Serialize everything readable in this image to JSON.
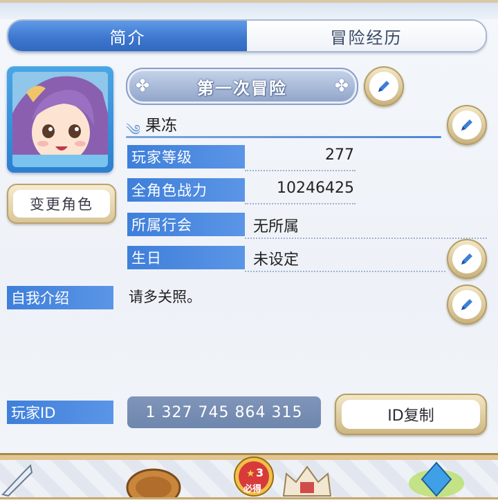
{
  "tabs": [
    {
      "label": "简介",
      "active": true
    },
    {
      "label": "冒险经历",
      "active": false
    }
  ],
  "profile": {
    "change_character_label": "变更角色",
    "title_banner": "第一次冒险",
    "name": "果冻",
    "rows": [
      {
        "label": "玩家等级",
        "value": "277"
      },
      {
        "label": "全角色战力",
        "value": "10246425"
      },
      {
        "label": "所属行会",
        "value": "无所属"
      },
      {
        "label": "生日",
        "value": "未设定"
      }
    ],
    "self_intro_label": "自我介绍",
    "self_intro_text": "请多关照。",
    "player_id_label": "玩家ID",
    "player_id": "1 327 745 864 315",
    "copy_id_label": "ID复制"
  },
  "bottom_bar": {
    "badge_text": "3",
    "badge_sub": "必得"
  },
  "colors": {
    "accent_blue": "#3f78cf",
    "label_blue": "#4d88df",
    "gold_border": "#b59d68",
    "id_box": "#7a90b5"
  },
  "icons": [
    "pencil-icon",
    "clover-icon",
    "swirl-icon",
    "sword-icon",
    "shield-icon",
    "star-badge-icon",
    "crown-icon",
    "gem-icon"
  ]
}
